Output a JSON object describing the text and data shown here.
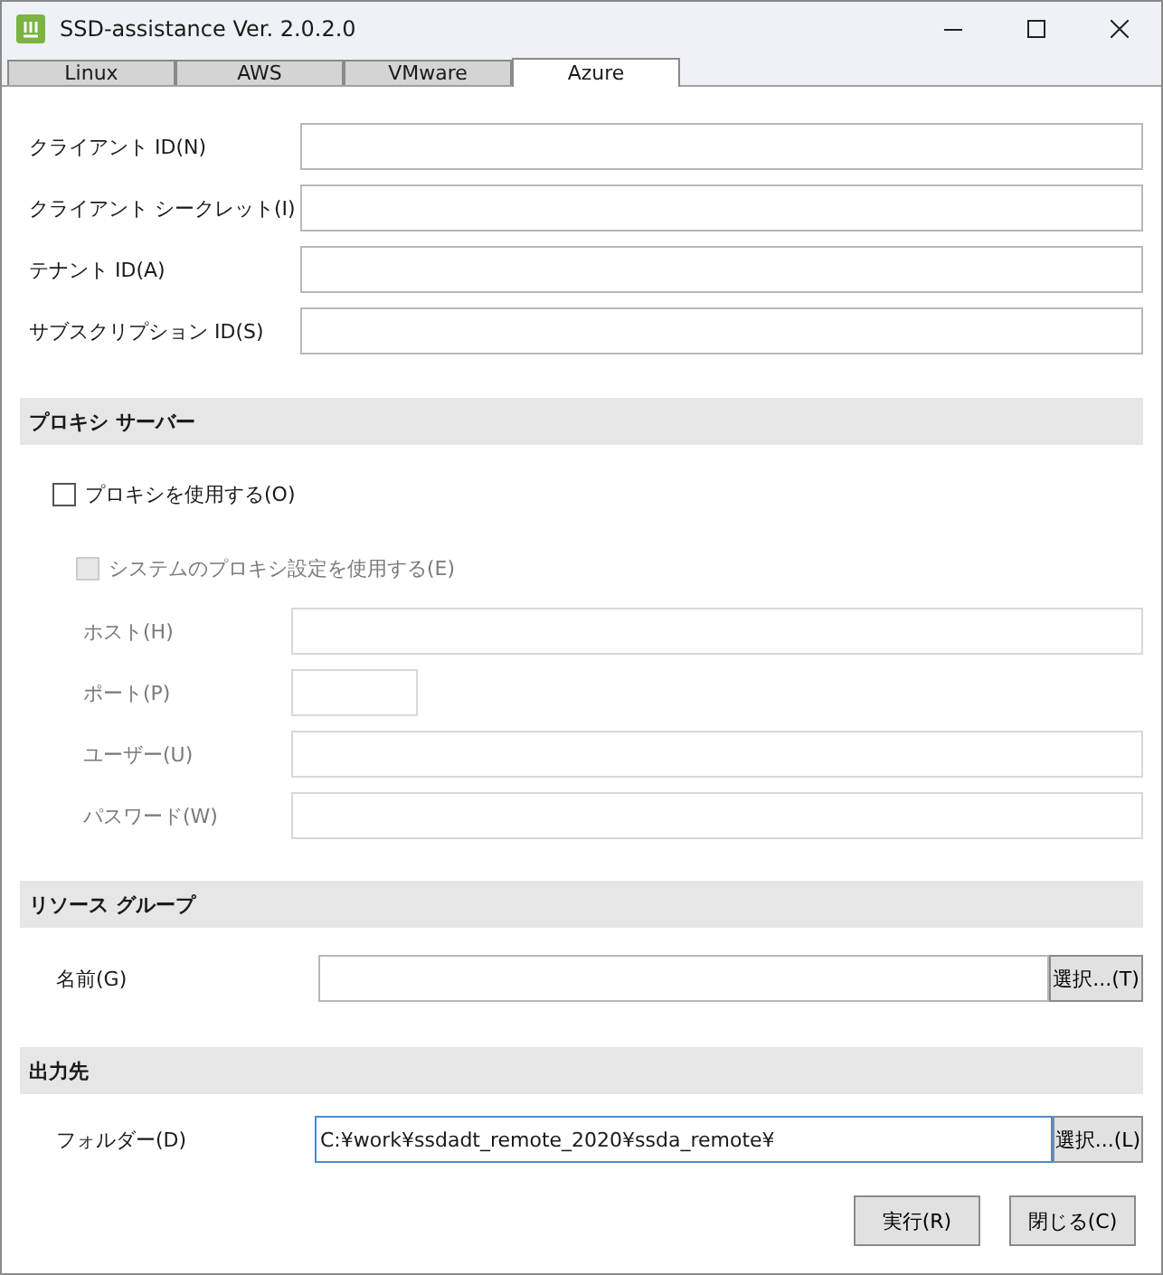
{
  "window": {
    "title": "SSD-assistance Ver. 2.0.2.0"
  },
  "tabs": [
    {
      "label": "Linux",
      "selected": false
    },
    {
      "label": "AWS",
      "selected": false
    },
    {
      "label": "VMware",
      "selected": false
    },
    {
      "label": "Azure",
      "selected": true
    }
  ],
  "credentials": [
    {
      "label": "クライアント ID(N)"
    },
    {
      "label": "クライアント シークレット(I)"
    },
    {
      "label": "テナント ID(A)"
    },
    {
      "label": "サブスクリプション ID(S)"
    }
  ],
  "proxy": {
    "header": "プロキシ サーバー",
    "use_proxy": {
      "label": "プロキシを使用する(O)",
      "checked": false
    },
    "system_proxy": {
      "label": "システムのプロキシ設定を使用する(E)",
      "checked": false,
      "disabled": true
    },
    "fields": [
      {
        "label": "ホスト(H)",
        "kind": "wide",
        "disabled": true
      },
      {
        "label": "ポート(P)",
        "kind": "short",
        "disabled": true
      },
      {
        "label": "ユーザー(U)",
        "kind": "wide",
        "disabled": true
      },
      {
        "label": "パスワード(W)",
        "kind": "wide",
        "disabled": true
      }
    ]
  },
  "resource_group": {
    "header": "リソース グループ",
    "label": "名前(G)",
    "button": "選択...(T)",
    "focused": false
  },
  "output": {
    "header": "出力先",
    "label": "フォルダー(D)",
    "value": "C:¥work¥ssdadt_remote_2020¥ssda_remote¥",
    "button": "選択...(L)",
    "focused": true
  },
  "buttons": [
    "実行(R)",
    "閉じる(C)"
  ]
}
